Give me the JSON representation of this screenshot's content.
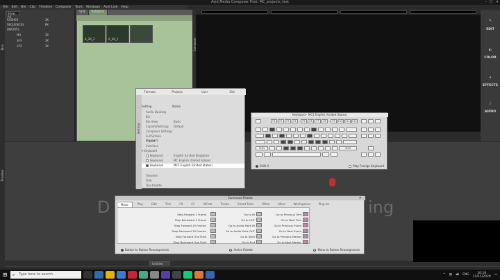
{
  "window": {
    "title": "Avid Media Composer First: MC_projects_test"
  },
  "menu": [
    "File",
    "Edit",
    "Bin",
    "Clip",
    "Timeline",
    "Composer",
    "Tools",
    "Windows",
    "Avid Link",
    "Help"
  ],
  "project": {
    "selector": "Show All",
    "side_label": "Bins",
    "bins": [
      {
        "name": "RUSHES",
        "size": "3K"
      },
      {
        "name": "SEQUENCES",
        "size": "6K"
      },
      {
        "name": "IMPORTS",
        "size": ""
      },
      {
        "name": "MX",
        "size": "3K"
      },
      {
        "name": "SFX",
        "size": "3K"
      },
      {
        "name": "VFX",
        "size": "3K"
      }
    ]
  },
  "bin_window": {
    "tabs": [
      "VFX",
      "RUSHES"
    ],
    "clips": [
      "A_26_2",
      "A_26_1",
      ""
    ]
  },
  "composer": {
    "side_label": "Composer"
  },
  "right_panel": {
    "items": [
      "EDIT",
      "COLOR",
      "EFFECTS",
      "AUDIO"
    ]
  },
  "timeline": {
    "side_label": "Timeline",
    "bg_left": "D",
    "bg_right": "ing",
    "track_selector": "Untitled"
  },
  "settings": {
    "side_label": "Settings",
    "tabs": [
      "Formats",
      "Projects",
      "User",
      "Site"
    ],
    "header": {
      "col1": "Setting",
      "col2": "Name"
    },
    "rows": [
      {
        "name": "Audio Ducking",
        "value": ""
      },
      {
        "name": "Bin",
        "value": ""
      },
      {
        "name": "Bin View",
        "value": "Basic"
      },
      {
        "name": "Clipinfo/Settings",
        "value": "Default"
      },
      {
        "name": "Composer Settings",
        "value": ""
      },
      {
        "name": "Full Screen Playback",
        "value": ""
      },
      {
        "name": "Import",
        "value": ""
      },
      {
        "name": "Interface",
        "value": ""
      },
      {
        "name": "Keyboard",
        "value": ""
      },
      {
        "name": "Keyboard",
        "value": "English (United Kingdom)"
      },
      {
        "name": "Keyboard",
        "value": "MC English (United States)"
      },
      {
        "name": "Keyboard",
        "value": "MC1 English (United States)"
      },
      {
        "name": "Timeline",
        "value": ""
      },
      {
        "name": "Trim",
        "value": ""
      },
      {
        "name": "Tool Palette",
        "value": ""
      }
    ]
  },
  "keyboard": {
    "title": "Keyboard - MC1 English (United States)",
    "fn_keys": [
      "F1",
      "F2",
      "F3",
      "F4",
      "F5",
      "F6",
      "F7",
      "F8",
      "F9",
      "F10",
      "F11",
      "F12"
    ],
    "shift_label": "Shift",
    "footer_left": "Shift 0",
    "footer_right": "Map Foreign Keyboard"
  },
  "command_palette": {
    "title": "Command Palette",
    "tabs": [
      "Move",
      "Play",
      "Edit",
      "Trim",
      "FX",
      "CC",
      "MCam",
      "Tracks",
      "Smart Tools",
      "Other",
      "More",
      "Workspaces",
      "Plug-Ins"
    ],
    "col1": [
      "Step Forward 1 Frame",
      "Step Backward 1 Frame",
      "Step Forward 10 Frames",
      "Step Backward 10 Frames",
      "Step Forward One Field",
      "Step Backward One Field"
    ],
    "col2": [
      "Go to IN",
      "Go to OUT",
      "Go to Audio Mark IN",
      "Go to Audio Mark OUT",
      "Go to Start",
      "Go to End"
    ],
    "col3": [
      "Go to Previous Trim",
      "Go to Next Trim",
      "Go to Previous Event",
      "Go to Next Event",
      "Go to Previous Marker",
      "Go to Next Marker"
    ],
    "footer": [
      "Button to Button Reassignment",
      "Active Palette",
      "Menu to Button Reassignment"
    ]
  },
  "taskbar": {
    "search_placeholder": "Type here to search",
    "lang": "ENG",
    "time": "10:16",
    "date": "11/11/2020"
  }
}
